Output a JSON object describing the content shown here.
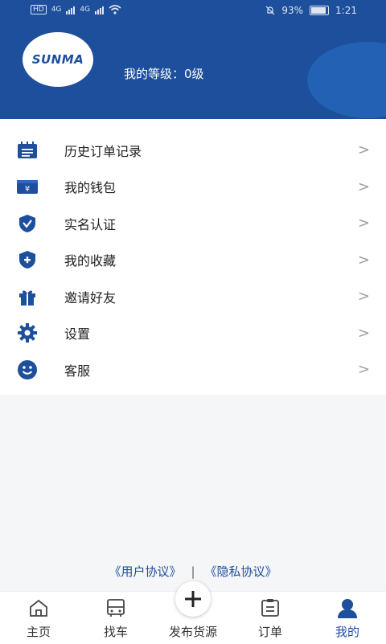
{
  "status_bar": {
    "left_hd": "HD",
    "net_tag_1": "4G",
    "net_tag_2": "4G",
    "battery_percent": "93%",
    "time": "1:21"
  },
  "header": {
    "logo_text": "SUNMA",
    "level_label": "我的等级：",
    "level_value": "0级"
  },
  "menu": {
    "items": [
      {
        "label": "历史订单记录",
        "icon": "calendar-list-icon"
      },
      {
        "label": "我的钱包",
        "icon": "wallet-icon"
      },
      {
        "label": "实名认证",
        "icon": "verified-shield-icon"
      },
      {
        "label": "我的收藏",
        "icon": "shield-plus-icon"
      },
      {
        "label": "邀请好友",
        "icon": "gift-icon"
      },
      {
        "label": "设置",
        "icon": "gear-icon"
      },
      {
        "label": "客服",
        "icon": "smiley-icon"
      }
    ],
    "chevron": ">"
  },
  "links": {
    "user_agreement": "《用户协议》",
    "separator": "|",
    "privacy": "《隐私协议》"
  },
  "tabbar": {
    "tabs": [
      {
        "label": "主页",
        "icon": "home-icon"
      },
      {
        "label": "找车",
        "icon": "bus-icon"
      },
      {
        "label": "发布货源",
        "icon": "plus-icon"
      },
      {
        "label": "订单",
        "icon": "clipboard-icon"
      },
      {
        "label": "我的",
        "icon": "user-icon",
        "active": true
      }
    ]
  },
  "colors": {
    "primary": "#1d4f9c",
    "text": "#222222",
    "chevron": "#9aa0a8"
  }
}
